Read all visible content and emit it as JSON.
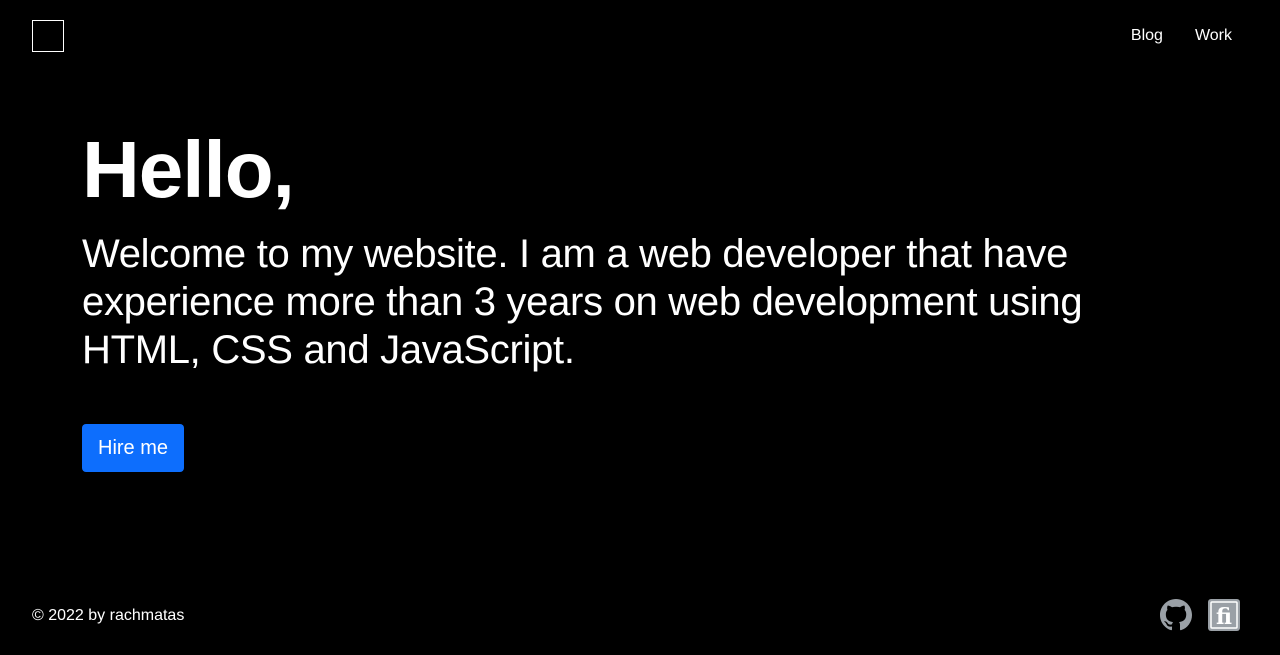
{
  "header": {
    "nav": [
      {
        "label": "Blog"
      },
      {
        "label": "Work"
      }
    ]
  },
  "hero": {
    "title": "Hello,",
    "text": "Welcome to my website. I am a web developer that have experience more than 3 years on web development using HTML, CSS and JavaScript.",
    "button_label": "Hire me"
  },
  "footer": {
    "copyright": "© 2022 by rachmatas",
    "icons": [
      "github-icon",
      "freecodecamp-icon"
    ]
  },
  "colors": {
    "background": "#000000",
    "text": "#ffffff",
    "accent": "#0d6efd",
    "icon": "#9aa0a6"
  }
}
